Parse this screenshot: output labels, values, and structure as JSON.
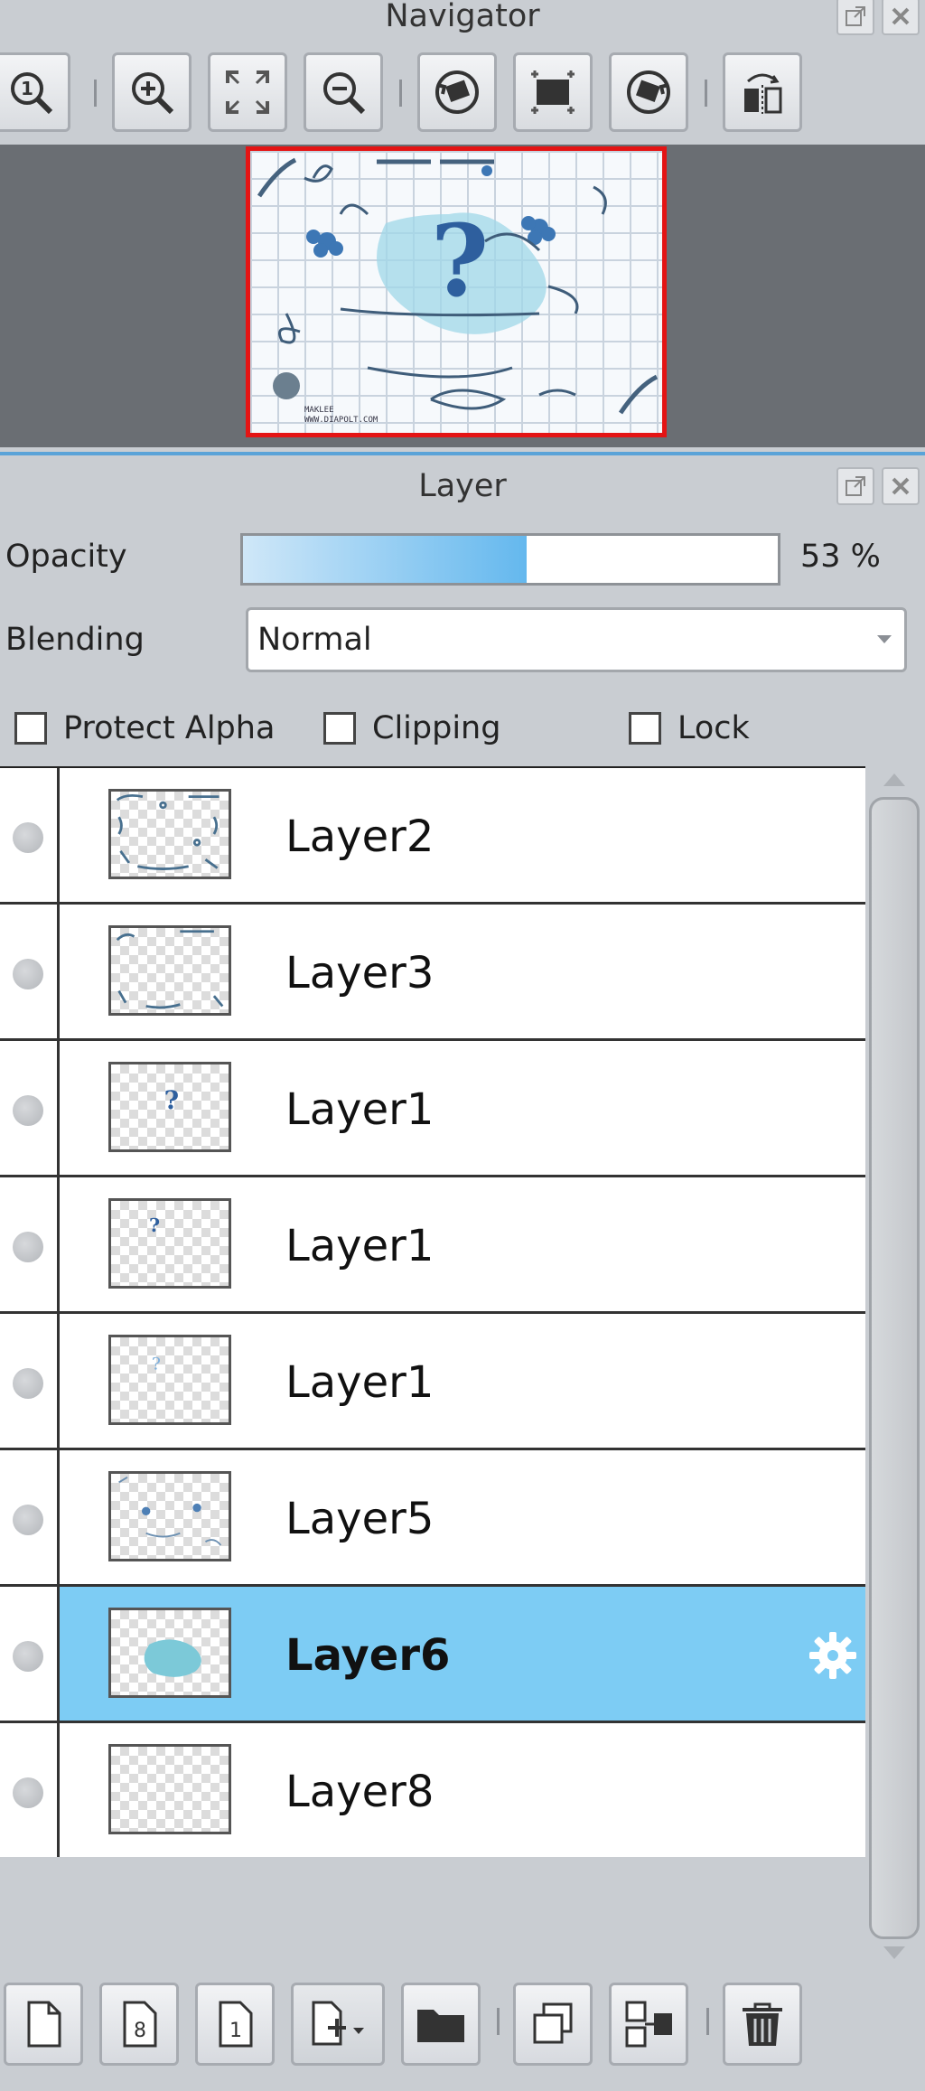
{
  "navigator": {
    "title": "Navigator",
    "tools": [
      {
        "name": "zoom-actual-size-icon"
      },
      {
        "name": "zoom-in-icon"
      },
      {
        "name": "fit-to-window-icon"
      },
      {
        "name": "zoom-out-icon"
      },
      {
        "name": "rotate-left-icon"
      },
      {
        "name": "rotate-reset-icon"
      },
      {
        "name": "rotate-right-icon"
      },
      {
        "name": "flip-horizontal-icon"
      }
    ],
    "thumbnail_caption_line1": "MAKLEE",
    "thumbnail_caption_line2": "WWW.DIAPOLT.COM"
  },
  "layer_panel": {
    "title": "Layer",
    "opacity_label": "Opacity",
    "opacity_value": "53 %",
    "opacity_fraction": 0.53,
    "blending_label": "Blending",
    "blending_value": "Normal",
    "protect_alpha_label": "Protect Alpha",
    "clipping_label": "Clipping",
    "lock_label": "Lock",
    "layers": [
      {
        "name": "Layer2",
        "selected": false
      },
      {
        "name": "Layer3",
        "selected": false
      },
      {
        "name": "Layer1",
        "selected": false
      },
      {
        "name": "Layer1",
        "selected": false
      },
      {
        "name": "Layer1",
        "selected": false
      },
      {
        "name": "Layer5",
        "selected": false
      },
      {
        "name": "Layer6",
        "selected": true
      },
      {
        "name": "Layer8",
        "selected": false
      }
    ],
    "bottom_tools": [
      {
        "name": "new-layer-icon"
      },
      {
        "name": "new-8bit-layer-icon",
        "label": "8"
      },
      {
        "name": "new-1bit-layer-icon",
        "label": "1"
      },
      {
        "name": "add-layer-dropdown-icon"
      },
      {
        "name": "new-folder-icon"
      },
      {
        "name": "duplicate-layer-icon"
      },
      {
        "name": "merge-down-icon"
      },
      {
        "name": "delete-layer-icon"
      }
    ]
  },
  "colors": {
    "selected_row": "#7dccf4",
    "opacity_fill": "#64b8ee",
    "nav_frame": "#e41414"
  }
}
